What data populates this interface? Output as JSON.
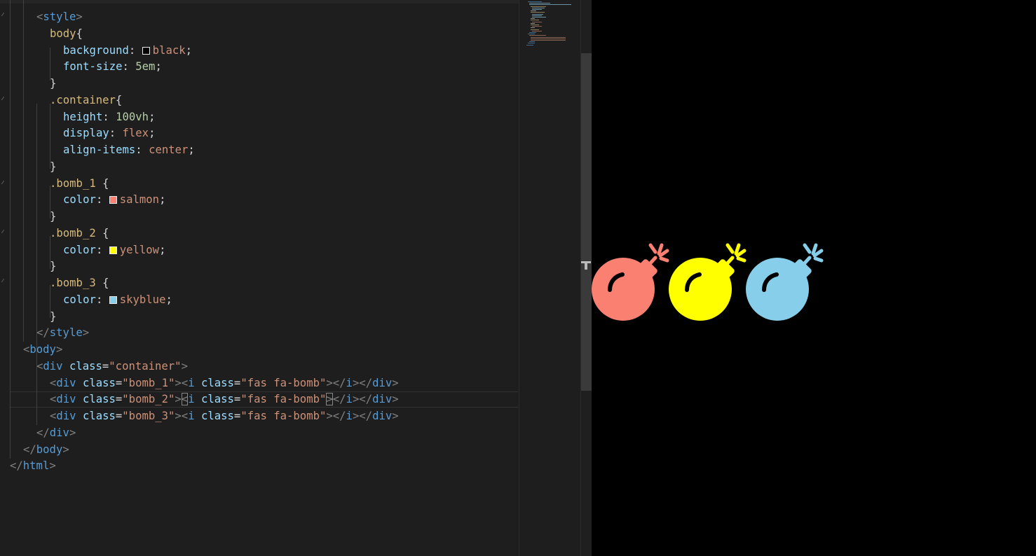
{
  "editor": {
    "lines": [
      [
        [
          "t-punc",
          "<"
        ],
        [
          "t-tag",
          "style"
        ],
        [
          "t-punc",
          ">"
        ]
      ],
      [
        [
          "t-sel",
          "body"
        ],
        [
          "t-brace",
          "{"
        ]
      ],
      [
        [
          "t-prop",
          "background"
        ],
        [
          "t-text",
          ": "
        ],
        [
          "swatch",
          "#000000"
        ],
        [
          "t-val",
          "black"
        ],
        [
          "t-text",
          ";"
        ]
      ],
      [
        [
          "t-prop",
          "font-size"
        ],
        [
          "t-text",
          ": "
        ],
        [
          "t-num",
          "5em"
        ],
        [
          "t-text",
          ";"
        ]
      ],
      [
        [
          "t-brace",
          "}"
        ]
      ],
      [
        [
          "t-sel",
          ".container"
        ],
        [
          "t-brace",
          "{"
        ]
      ],
      [
        [
          "t-prop",
          "height"
        ],
        [
          "t-text",
          ": "
        ],
        [
          "t-num",
          "100vh"
        ],
        [
          "t-text",
          ";"
        ]
      ],
      [
        [
          "t-prop",
          "display"
        ],
        [
          "t-text",
          ": "
        ],
        [
          "t-val",
          "flex"
        ],
        [
          "t-text",
          ";"
        ]
      ],
      [
        [
          "t-prop",
          "align-items"
        ],
        [
          "t-text",
          ": "
        ],
        [
          "t-val",
          "center"
        ],
        [
          "t-text",
          ";"
        ]
      ],
      [
        [
          "t-brace",
          "}"
        ]
      ],
      [
        [
          "t-sel",
          ".bomb_1"
        ],
        [
          "t-text",
          " "
        ],
        [
          "t-brace",
          "{"
        ]
      ],
      [
        [
          "t-prop",
          "color"
        ],
        [
          "t-text",
          ": "
        ],
        [
          "swatch",
          "#fa8072"
        ],
        [
          "t-val",
          "salmon"
        ],
        [
          "t-text",
          ";"
        ]
      ],
      [
        [
          "t-brace",
          "}"
        ]
      ],
      [
        [
          "t-sel",
          ".bomb_2"
        ],
        [
          "t-text",
          " "
        ],
        [
          "t-brace",
          "{"
        ]
      ],
      [
        [
          "t-prop",
          "color"
        ],
        [
          "t-text",
          ": "
        ],
        [
          "swatch",
          "#ffff00"
        ],
        [
          "t-val",
          "yellow"
        ],
        [
          "t-text",
          ";"
        ]
      ],
      [
        [
          "t-brace",
          "}"
        ]
      ],
      [
        [
          "t-sel",
          ".bomb_3"
        ],
        [
          "t-text",
          " "
        ],
        [
          "t-brace",
          "{"
        ]
      ],
      [
        [
          "t-prop",
          "color"
        ],
        [
          "t-text",
          ": "
        ],
        [
          "swatch",
          "#87ceeb"
        ],
        [
          "t-val",
          "skyblue"
        ],
        [
          "t-text",
          ";"
        ]
      ],
      [
        [
          "t-brace",
          "}"
        ]
      ],
      [
        [
          "t-punc",
          "</"
        ],
        [
          "t-tag",
          "style"
        ],
        [
          "t-punc",
          ">"
        ]
      ],
      [
        [
          "t-punc",
          "<"
        ],
        [
          "t-tag",
          "body"
        ],
        [
          "t-punc",
          ">"
        ]
      ],
      [
        [
          "t-punc",
          "<"
        ],
        [
          "t-tag",
          "div"
        ],
        [
          "t-text",
          " "
        ],
        [
          "t-attr",
          "class"
        ],
        [
          "t-eq",
          "="
        ],
        [
          "t-str",
          "\"container\""
        ],
        [
          "t-punc",
          ">"
        ]
      ],
      [
        [
          "t-punc",
          "<"
        ],
        [
          "t-tag",
          "div"
        ],
        [
          "t-text",
          " "
        ],
        [
          "t-attr",
          "class"
        ],
        [
          "t-eq",
          "="
        ],
        [
          "t-str",
          "\"bomb_1\""
        ],
        [
          "t-punc",
          ">"
        ],
        [
          "t-punc",
          "<"
        ],
        [
          "t-tag",
          "i"
        ],
        [
          "t-text",
          " "
        ],
        [
          "t-attr",
          "class"
        ],
        [
          "t-eq",
          "="
        ],
        [
          "t-str",
          "\"fas fa-bomb\""
        ],
        [
          "t-punc",
          ">"
        ],
        [
          "t-punc",
          "</"
        ],
        [
          "t-tag",
          "i"
        ],
        [
          "t-punc",
          ">"
        ],
        [
          "t-punc",
          "</"
        ],
        [
          "t-tag",
          "div"
        ],
        [
          "t-punc",
          ">"
        ]
      ],
      [
        [
          "t-punc",
          "<"
        ],
        [
          "t-tag",
          "div"
        ],
        [
          "t-text",
          " "
        ],
        [
          "t-attr",
          "class"
        ],
        [
          "t-eq",
          "="
        ],
        [
          "t-str",
          "\"bomb_2\""
        ],
        [
          "t-punc",
          ">"
        ],
        [
          "t-punc-box",
          "<"
        ],
        [
          "t-tag",
          "i"
        ],
        [
          "t-text",
          " "
        ],
        [
          "t-attr",
          "class"
        ],
        [
          "t-eq",
          "="
        ],
        [
          "t-str",
          "\"fas fa-bomb\""
        ],
        [
          "t-punc-box",
          ">"
        ],
        [
          "t-punc",
          "</"
        ],
        [
          "t-tag",
          "i"
        ],
        [
          "t-punc",
          ">"
        ],
        [
          "t-punc",
          "</"
        ],
        [
          "t-tag",
          "div"
        ],
        [
          "t-punc",
          ">"
        ]
      ],
      [
        [
          "t-punc",
          "<"
        ],
        [
          "t-tag",
          "div"
        ],
        [
          "t-text",
          " "
        ],
        [
          "t-attr",
          "class"
        ],
        [
          "t-eq",
          "="
        ],
        [
          "t-str",
          "\"bomb_3\""
        ],
        [
          "t-punc",
          ">"
        ],
        [
          "t-punc",
          "<"
        ],
        [
          "t-tag",
          "i"
        ],
        [
          "t-text",
          " "
        ],
        [
          "t-attr",
          "class"
        ],
        [
          "t-eq",
          "="
        ],
        [
          "t-str",
          "\"fas fa-bomb\""
        ],
        [
          "t-punc",
          ">"
        ],
        [
          "t-punc",
          "</"
        ],
        [
          "t-tag",
          "i"
        ],
        [
          "t-punc",
          ">"
        ],
        [
          "t-punc",
          "</"
        ],
        [
          "t-tag",
          "div"
        ],
        [
          "t-punc",
          ">"
        ]
      ],
      [
        [
          "t-punc",
          "</"
        ],
        [
          "t-tag",
          "div"
        ],
        [
          "t-punc",
          ">"
        ]
      ],
      [
        [
          "t-punc",
          "</"
        ],
        [
          "t-tag",
          "body"
        ],
        [
          "t-punc",
          ">"
        ]
      ],
      [
        [
          "t-punc",
          "</"
        ],
        [
          "t-tag",
          "html"
        ],
        [
          "t-punc",
          ">"
        ]
      ]
    ],
    "current_line": 23
  },
  "preview": {
    "background": "#000000",
    "bombs": [
      {
        "name": "bomb_1",
        "color": "#fa8072",
        "icon": "bomb-icon"
      },
      {
        "name": "bomb_2",
        "color": "#ffff00",
        "icon": "bomb-icon"
      },
      {
        "name": "bomb_3",
        "color": "#87ceeb",
        "icon": "bomb-icon"
      }
    ]
  }
}
